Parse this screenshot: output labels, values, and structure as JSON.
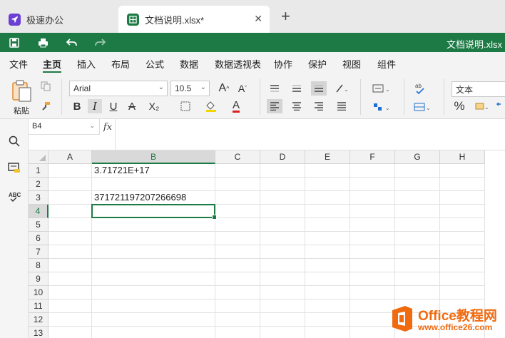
{
  "tabs": [
    {
      "label": "极速办公",
      "icon": "rocket-icon"
    },
    {
      "label": "文档说明.xlsx*",
      "icon": "spreadsheet-icon"
    }
  ],
  "quickbar": {
    "doc_title": "文档说明.xlsx"
  },
  "menu": [
    "文件",
    "主页",
    "插入",
    "布局",
    "公式",
    "数据",
    "数据透视表",
    "协作",
    "保护",
    "视图",
    "组件"
  ],
  "ribbon": {
    "paste_label": "粘贴",
    "font_name": "Arial",
    "font_size": "10.5",
    "number_format": "文本",
    "bold": "B",
    "italic": "I",
    "underline": "U",
    "strike": "A",
    "subscript": "X₂",
    "percent": "%"
  },
  "formula": {
    "name_box": "B4",
    "fx": "fx",
    "content": ""
  },
  "grid": {
    "columns": [
      "A",
      "B",
      "C",
      "D",
      "E",
      "F",
      "G",
      "H"
    ],
    "rows": [
      "1",
      "2",
      "3",
      "4",
      "5",
      "6",
      "7",
      "8",
      "9",
      "10",
      "11",
      "12",
      "13"
    ],
    "selected_column": "B",
    "selected_row": "4",
    "cells": {
      "B1": "3.71721E+17",
      "B3": "371721197207266698"
    }
  },
  "watermark": {
    "title": "Office教程网",
    "url": "www.office26.com"
  },
  "colors": {
    "accent": "#1e7a45",
    "watermark": "#f06a0f"
  }
}
